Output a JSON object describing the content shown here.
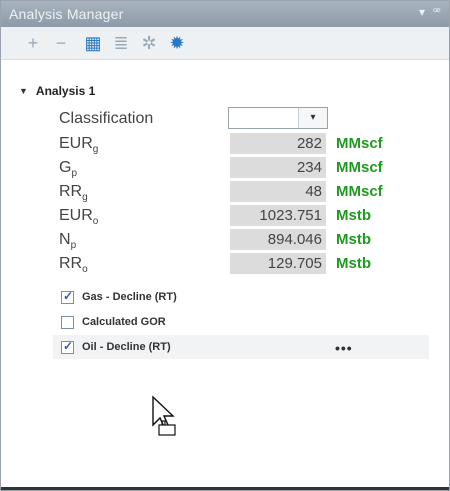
{
  "window": {
    "title": "Analysis Manager",
    "controls": [
      "▾",
      "ꟹ"
    ]
  },
  "toolbar": {
    "buttons": [
      {
        "name": "add",
        "glyph": "+"
      },
      {
        "name": "remove",
        "glyph": "−"
      },
      {
        "name": "grid",
        "glyph": "▦"
      },
      {
        "name": "doc",
        "glyph": "≣"
      },
      {
        "name": "sun",
        "glyph": "✲"
      },
      {
        "name": "star",
        "glyph": "✹"
      }
    ]
  },
  "tree": {
    "root": "Analysis 1",
    "rows": [
      {
        "label": "Classification",
        "value": "",
        "unit": ""
      },
      {
        "label": "EUR",
        "sub": "g",
        "value": "282",
        "unit": "MMscf"
      },
      {
        "label": "G",
        "sub": "p",
        "value": "234",
        "unit": "MMscf"
      },
      {
        "label": "RR",
        "sub": "g",
        "value": "48",
        "unit": "MMscf"
      },
      {
        "label": "EUR",
        "sub": "o",
        "value": "1023.751",
        "unit": "Mstb"
      },
      {
        "label": "N",
        "sub": "p",
        "value": "894.046",
        "unit": "Mstb"
      },
      {
        "label": "RR",
        "sub": "o",
        "value": "129.705",
        "unit": "Mstb"
      }
    ],
    "checks": [
      {
        "label": "Gas - Decline (RT)",
        "checked": true
      },
      {
        "label": "Calculated GOR",
        "checked": false
      },
      {
        "label": "Oil - Decline (RT)",
        "checked": true,
        "extra": "•••"
      }
    ]
  },
  "colors": {
    "unit": "#1f9a1f",
    "titlebar": "#8e9aa7"
  }
}
